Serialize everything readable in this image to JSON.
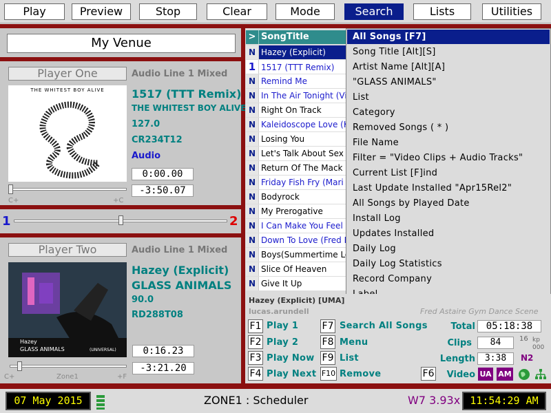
{
  "menu": [
    "Play",
    "Preview",
    "Stop",
    "Clear",
    "Mode",
    "Search",
    "Lists",
    "Utilities"
  ],
  "venue": "My Venue",
  "player_one": {
    "label": "Player One",
    "source": "Audio Line 1 Mixed",
    "album_text": "THE WHITEST BOY ALIVE",
    "title": "1517 (TTT Remix)",
    "artist": "THE WHITEST BOY ALIVE",
    "bpm": "127.0",
    "code": "CR234T12",
    "type": "Audio",
    "elapsed": "0:00.00",
    "remaining": "-3:50.07",
    "slider_left": "C+",
    "slider_right": "+C"
  },
  "crossfader": {
    "left": "1",
    "right": "2",
    "position": 0.5
  },
  "player_two": {
    "label": "Player Two",
    "source": "Audio Line 1 Mixed",
    "album_artist": "Hazey",
    "album_label": "GLASS ANIMALS",
    "album_publisher": "(UNIVERSAL)",
    "title": "Hazey (Explicit)",
    "artist": "GLASS ANIMALS",
    "bpm": "90.0",
    "code": "RD288T08",
    "elapsed": "0:16.23",
    "remaining": "-3:21.20",
    "slider_left": "C+",
    "slider_mid": "Zone1",
    "slider_right": "+F"
  },
  "songlist": {
    "header_marker": ">",
    "header_title": "SongTitle",
    "rows": [
      {
        "n": "N",
        "title": "Hazey (Explicit)",
        "selected": true,
        "color": "#ffffff"
      },
      {
        "n": "1",
        "title": "1517 (TTT Remix)",
        "color": "#1a1acc"
      },
      {
        "n": "N",
        "title": "Remind Me",
        "color": "#1a1acc"
      },
      {
        "n": "N",
        "title": "In The Air Tonight (Vi",
        "color": "#1a1acc"
      },
      {
        "n": "N",
        "title": "Right On Track",
        "color": "#000000"
      },
      {
        "n": "N",
        "title": "Kaleidoscope Love (K",
        "color": "#1a1acc"
      },
      {
        "n": "N",
        "title": "Losing You",
        "color": "#000000"
      },
      {
        "n": "N",
        "title": "Let's Talk About Sex",
        "color": "#000000"
      },
      {
        "n": "N",
        "title": "Return Of The Mack",
        "color": "#000000"
      },
      {
        "n": "N",
        "title": "Friday Fish Fry (Mari",
        "color": "#1a1acc"
      },
      {
        "n": "N",
        "title": "Bodyrock",
        "color": "#000000"
      },
      {
        "n": "N",
        "title": "My Prerogative",
        "color": "#000000"
      },
      {
        "n": "N",
        "title": "I Can Make You Feel",
        "color": "#1a1acc"
      },
      {
        "n": "N",
        "title": "Down To Love (Fred E",
        "color": "#1a1acc"
      },
      {
        "n": "N",
        "title": "Boys(Summertime Lo",
        "color": "#000000"
      },
      {
        "n": "N",
        "title": "Slice Of Heaven",
        "color": "#000000"
      },
      {
        "n": "N",
        "title": "Give It Up",
        "color": "#000000"
      }
    ]
  },
  "search_menu": [
    "All Songs [F7]",
    "Song Title [Alt][S]",
    "Artist Name [Alt][A]",
    "\"GLASS ANIMALS\"",
    "List",
    "Category",
    "Removed Songs ( * )",
    "File Name",
    "Filter = \"Video Clips + Audio Tracks\"",
    "Current List [F]ind",
    "Last Update Installed \"Apr15Rel2\"",
    "All Songs by Played Date",
    "Install Log",
    "Updates Installed",
    "Daily Log",
    "Daily Log Statistics",
    "Record Company",
    "Label"
  ],
  "now_playing": {
    "info": "Hazey (Explicit) [UMA]",
    "user": "lucas.arundell",
    "scene": "Fred Astaire Gym Dance Scene"
  },
  "fkeys": [
    {
      "key": "F1",
      "label": "Play 1"
    },
    {
      "key": "F2",
      "label": "Play 2"
    },
    {
      "key": "F3",
      "label": "Play Now"
    },
    {
      "key": "F4",
      "label": "Play Next"
    },
    {
      "key": "F7",
      "label": "Search All Songs"
    },
    {
      "key": "F8",
      "label": "Menu"
    },
    {
      "key": "F9",
      "label": "List"
    },
    {
      "key": "F10",
      "label": "Remove"
    },
    {
      "key": "F6",
      "label": ""
    }
  ],
  "stats": {
    "total_label": "Total",
    "total": "05:18:38",
    "clips_label": "Clips",
    "clips": "84",
    "length_label": "Length",
    "length": "3:38",
    "video_label": "Video",
    "sr_top": "16",
    "sr_unit": "kp",
    "sr_bottom": "000",
    "n2": "N2",
    "ua": "UA",
    "am": "AM"
  },
  "status": {
    "date": "07 May 2015",
    "zone": "ZONE1 : Scheduler",
    "version": "W7 3.93x",
    "time": "11:54:29 AM"
  },
  "colors": {
    "accent": "#0a1e8c",
    "teal": "#008080",
    "divider": "#8b1010",
    "blue": "#1a1acc"
  }
}
